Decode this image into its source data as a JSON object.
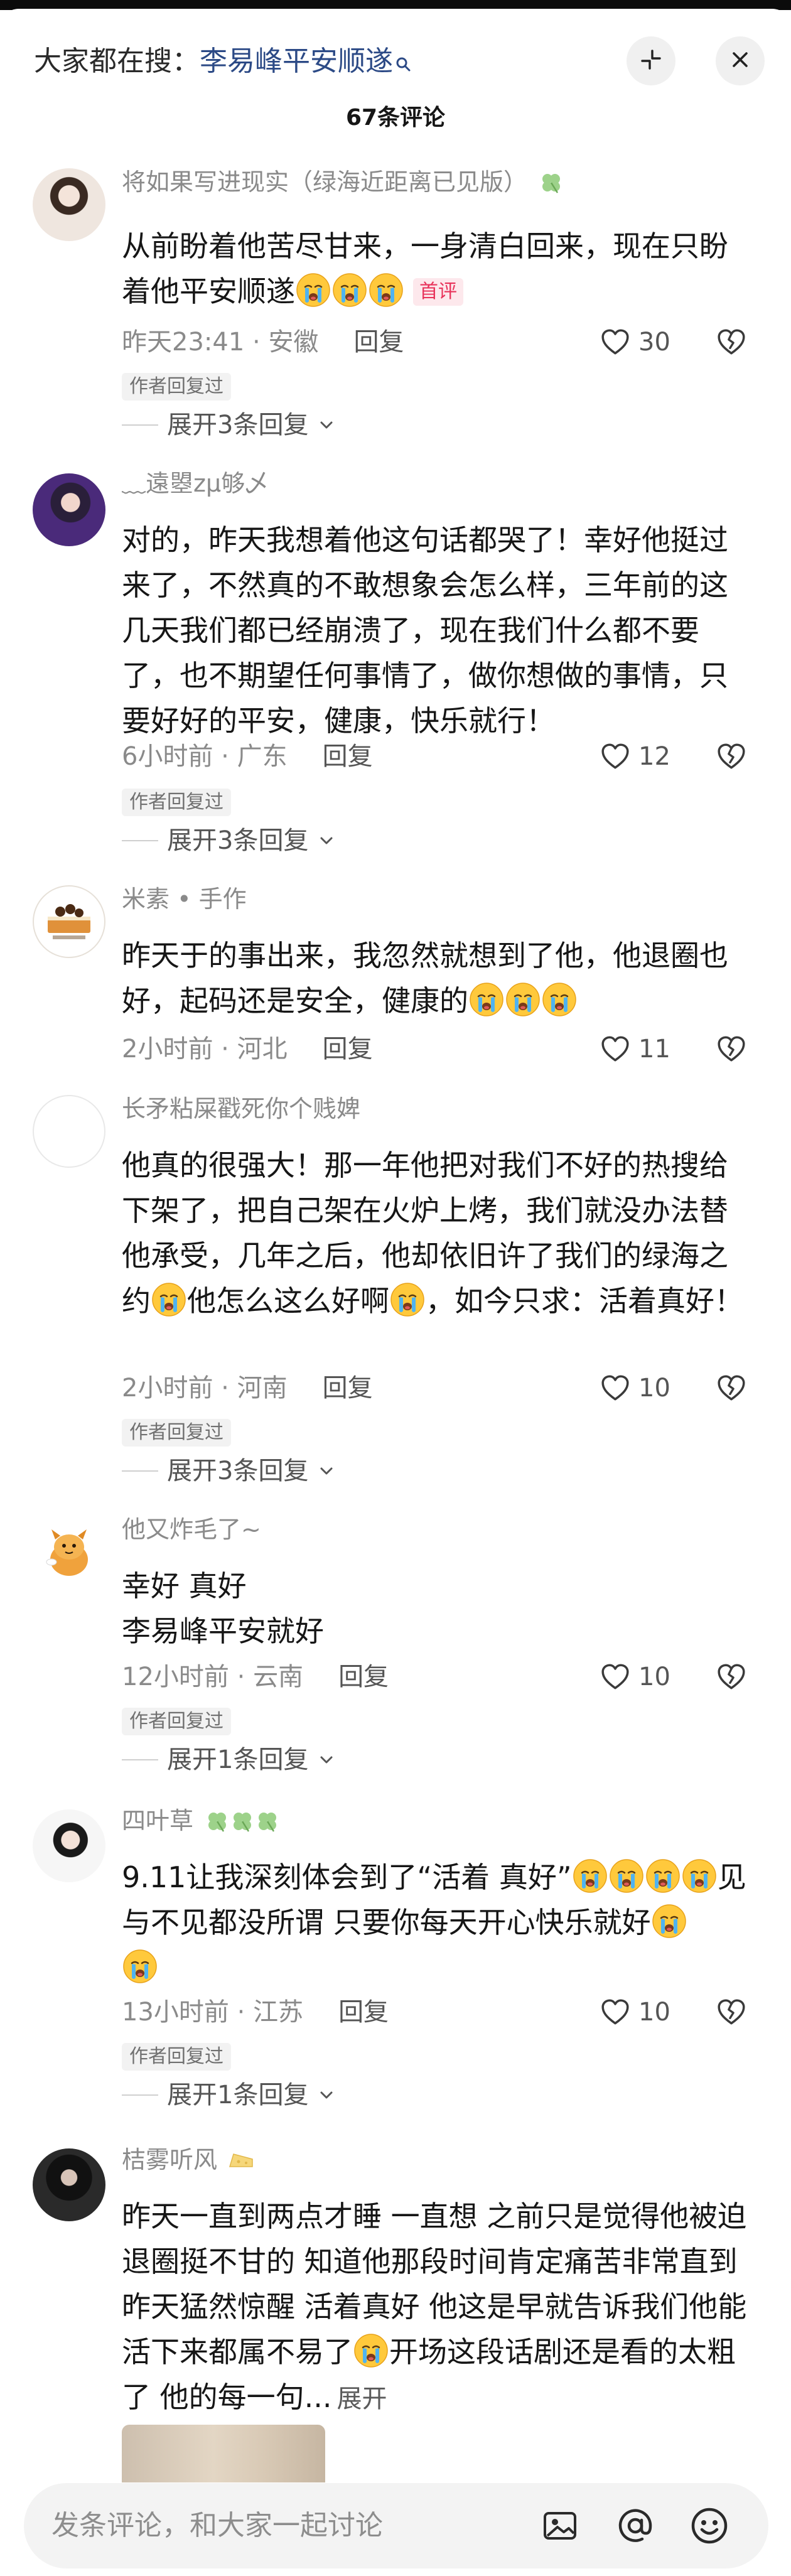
{
  "header": {
    "search_prefix": "大家都在搜：",
    "search_keyword": "李易峰平安顺遂",
    "comment_count": "67条评论"
  },
  "icons": {
    "collapse": "collapse-arrows-icon",
    "close": "close-icon",
    "like": "heart-outline-icon",
    "dislike": "broken-heart-outline-icon",
    "emoji": "crying-face-emoji",
    "clover": "clover-emoji"
  },
  "colors": {
    "keyword": "#2c4a86",
    "first_badge": "#e8325a",
    "clover": "#8fc77a"
  },
  "comments": [
    {
      "username": "将如果写进现实（绿海近距离已见版）",
      "text": "从前盼着他苦尽甘来，一身清白回来，现在只盼着他平安顺遂",
      "badge": "首评",
      "time": "昨天23:41",
      "location": "安徽",
      "reply_label": "回复",
      "likes": "30",
      "author_tag": "作者回复过",
      "expand": "展开3条回复"
    },
    {
      "username": "﹏遠曌zμ够乄",
      "text": "对的，昨天我想着他这句话都哭了！幸好他挺过来了，不然真的不敢想象会怎么样，三年前的这几天我们都已经崩溃了，现在我们什么都不要了，也不期望任何事情了，做你想做的事情，只要好好的平安，健康，快乐就行！",
      "time": "6小时前",
      "location": "广东",
      "reply_label": "回复",
      "likes": "12",
      "author_tag": "作者回复过",
      "expand": "展开3条回复"
    },
    {
      "username": "米素 • 手作",
      "text": "昨天于的事出来，我忽然就想到了他，他退圈也好，起码还是安全，健康的",
      "time": "2小时前",
      "location": "河北",
      "reply_label": "回复",
      "likes": "11"
    },
    {
      "username": "长矛粘屎戳死你个贱婢",
      "text_part1": "他真的很强大！那一年他把对我们不好的热搜给下架了，把自己架在火炉上烤，我们就没办法替他承受，几年之后，他却依旧许了我们的绿海之约",
      "text_part2": "他怎么这么好啊",
      "text_part3": "，如今只求：活着真好！",
      "time": "2小时前",
      "location": "河南",
      "reply_label": "回复",
      "likes": "10",
      "author_tag": "作者回复过",
      "expand": "展开3条回复"
    },
    {
      "username": "他又炸毛了~",
      "text_line1": "幸好 真好",
      "text_line2": "李易峰平安就好",
      "time": "12小时前",
      "location": "云南",
      "reply_label": "回复",
      "likes": "10",
      "author_tag": "作者回复过",
      "expand": "展开1条回复"
    },
    {
      "username": "四叶草",
      "text_part1": "9.11让我深刻体会到了“活着 真好”",
      "text_part2": "见与不见都没所谓 只要你每天开心快乐就好",
      "time": "13小时前",
      "location": "江苏",
      "reply_label": "回复",
      "likes": "10",
      "author_tag": "作者回复过",
      "expand": "展开1条回复"
    },
    {
      "username": "桔雾听风",
      "text_part1": "昨天一直到两点才睡 一直想 之前只是觉得他被迫退圈挺不甘的 知道他那段时间肯定痛苦非常直到昨天猛然惊醒 活着真好 他这是早就告诉我们他能活下来都属不易了",
      "text_part2": "开场这段话剧还是看的太粗了 他的每一句...",
      "expand_inline": "展开"
    }
  ],
  "bottom": {
    "placeholder": "发条评论，和大家一起讨论",
    "image_icon": "image-icon",
    "at_icon": "at-sign-icon",
    "emoji_icon": "smiley-icon"
  }
}
